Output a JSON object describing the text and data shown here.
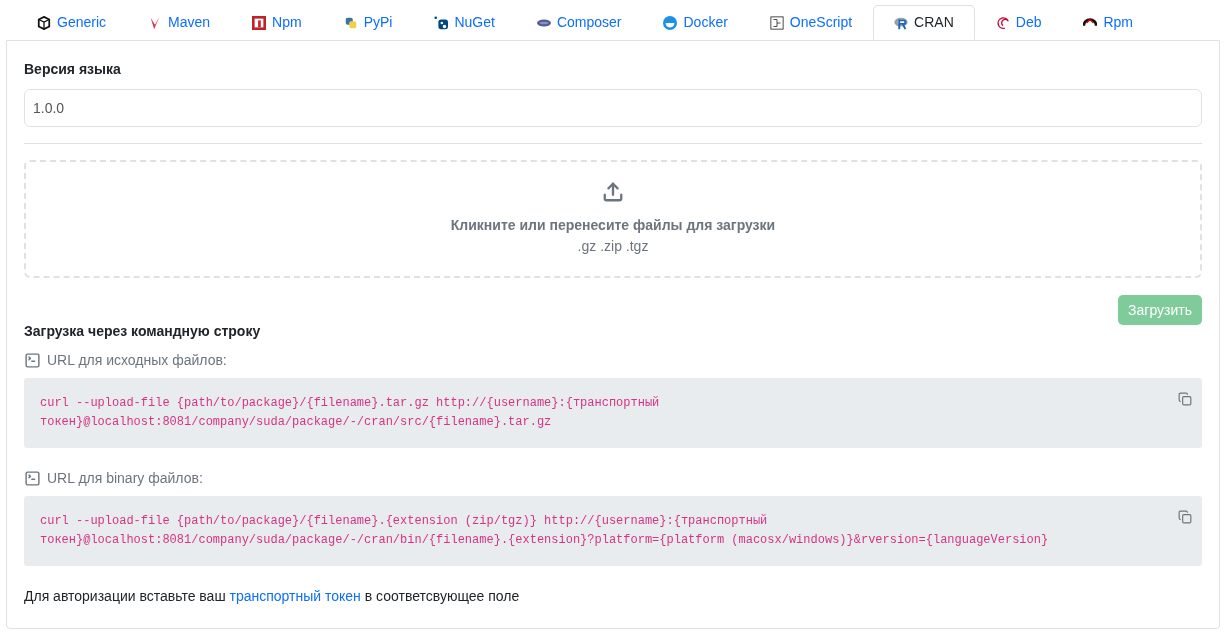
{
  "tabs": [
    {
      "label": "Generic",
      "selected": false
    },
    {
      "label": "Maven",
      "selected": false
    },
    {
      "label": "Npm",
      "selected": false
    },
    {
      "label": "PyPi",
      "selected": false
    },
    {
      "label": "NuGet",
      "selected": false
    },
    {
      "label": "Composer",
      "selected": false
    },
    {
      "label": "Docker",
      "selected": false
    },
    {
      "label": "OneScript",
      "selected": false
    },
    {
      "label": "CRAN",
      "selected": true
    },
    {
      "label": "Deb",
      "selected": false
    },
    {
      "label": "Rpm",
      "selected": false
    }
  ],
  "version": {
    "label": "Версия языка",
    "value": "1.0.0"
  },
  "dropzone": {
    "title": "Кликните или перенесите файлы для загрузки",
    "extensions": ".gz .zip .tgz"
  },
  "upload_button": {
    "label": "Загрузить",
    "disabled": true
  },
  "cli": {
    "title": "Загрузка через командную строку",
    "blocks": [
      {
        "label": "URL для исходных файлов:",
        "command": "curl --upload-file {path/to/package}/{filename}.tar.gz http://{username}:{транспортный токен}@localhost:8081/company/suda/package/-/cran/src/{filename}.tar.gz"
      },
      {
        "label": "URL для binary файлов:",
        "command": "curl --upload-file {path/to/package}/{filename}.{extension (zip/tgz)} http://{username}:{транспортный токен}@localhost:8081/company/suda/package/-/cran/bin/{filename}.{extension}?platform={platform (macosx/windows)}&rversion={languageVersion}"
      }
    ]
  },
  "footer": {
    "before": "Для авторизации вставьте ваш",
    "link": "транспортный токен",
    "after": "в соответсвующее поле"
  }
}
